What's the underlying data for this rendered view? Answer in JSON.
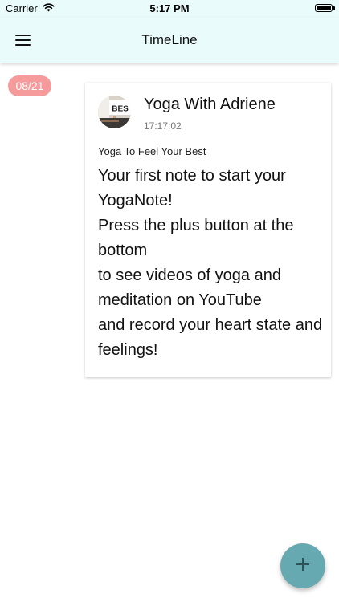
{
  "status_bar": {
    "carrier": "Carrier",
    "time": "5:17 PM",
    "icons": [
      "wifi-icon",
      "battery-icon"
    ]
  },
  "app_bar": {
    "title": "TimeLine",
    "background": "#e9fbfb",
    "menu_icon": "menu-icon"
  },
  "timeline": {
    "entries": [
      {
        "date": "08/21",
        "date_color": "#f59b9b",
        "channel_name": "Yoga With Adriene",
        "avatar_text": "BES",
        "time": "17:17:02",
        "video_title": "Yoga To Feel Your Best",
        "body": "Your first note to start your YogaNote!\nPress the plus button at the bottom\nto see videos of yoga and meditation on YouTube\nand record your heart state and feelings!"
      }
    ]
  },
  "fab": {
    "icon": "plus-icon",
    "color": "#67a9b0"
  }
}
